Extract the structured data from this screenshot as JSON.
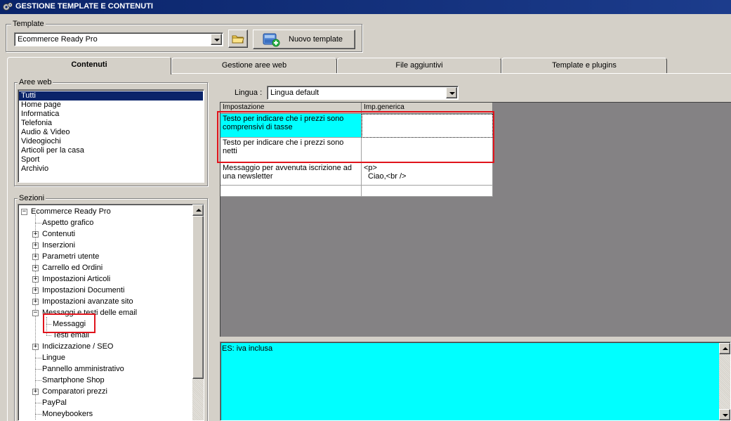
{
  "window": {
    "title": "GESTIONE TEMPLATE E CONTENUTI",
    "icon": "gear-app-icon"
  },
  "template": {
    "group_label": "Template",
    "selected": "Ecommerce Ready Pro",
    "new_button_label": "Nuovo template"
  },
  "tabs": [
    {
      "label": "Contenuti",
      "active": true
    },
    {
      "label": "Gestione aree web",
      "active": false
    },
    {
      "label": "File aggiuntivi",
      "active": false
    },
    {
      "label": "Template e plugins",
      "active": false
    }
  ],
  "aree_web": {
    "group_label": "Aree web",
    "items": [
      "Tutti",
      "Home page",
      "Informatica",
      "Telefonia",
      "Audio & Video",
      "Videogiochi",
      "Articoli per la casa",
      "Sport",
      "Archivio"
    ],
    "selected_index": 0
  },
  "sezioni": {
    "group_label": "Sezioni",
    "root": "Ecommerce Ready Pro",
    "items": [
      {
        "label": "Aspetto grafico",
        "expander": ""
      },
      {
        "label": "Contenuti",
        "expander": "+"
      },
      {
        "label": "Inserzioni",
        "expander": "+"
      },
      {
        "label": "Parametri utente",
        "expander": "+"
      },
      {
        "label": "Carrello ed Ordini",
        "expander": "+"
      },
      {
        "label": "Impostazioni Articoli",
        "expander": "+"
      },
      {
        "label": "Impostazioni Documenti",
        "expander": "+"
      },
      {
        "label": "Impostazioni avanzate sito",
        "expander": "+"
      },
      {
        "label": "Messaggi e testi delle email",
        "expander": "-"
      },
      {
        "label": "Indicizzazione / SEO",
        "expander": "+"
      },
      {
        "label": "Lingue",
        "expander": ""
      },
      {
        "label": "Pannello amministrativo",
        "expander": ""
      },
      {
        "label": "Smartphone Shop",
        "expander": ""
      },
      {
        "label": "Comparatori prezzi",
        "expander": "+"
      },
      {
        "label": "PayPal",
        "expander": ""
      },
      {
        "label": "Moneybookers",
        "expander": ""
      }
    ],
    "children": [
      "Messaggi",
      "Testi email"
    ]
  },
  "lingua": {
    "label": "Lingua :",
    "selected": "Lingua default"
  },
  "grid": {
    "headers": [
      "Impostazione",
      "Imp.generica"
    ],
    "rows": [
      {
        "setting": "Testo per indicare che i prezzi sono comprensivi di tasse",
        "value": ""
      },
      {
        "setting": "Testo per indicare che i prezzi sono netti",
        "value": ""
      },
      {
        "setting": "Messaggio per avvenuta iscrizione ad una newsletter",
        "value_line1": "<p>",
        "value_line2": "Ciao,<br />"
      },
      {
        "setting": "",
        "value": ""
      }
    ]
  },
  "editor": {
    "text": "ES: iva inclusa"
  },
  "colors": {
    "selection_cyan": "#00ffff",
    "highlight_red": "#e0141c",
    "title_blue": "#0a246a",
    "grid_bg": "#848284"
  }
}
